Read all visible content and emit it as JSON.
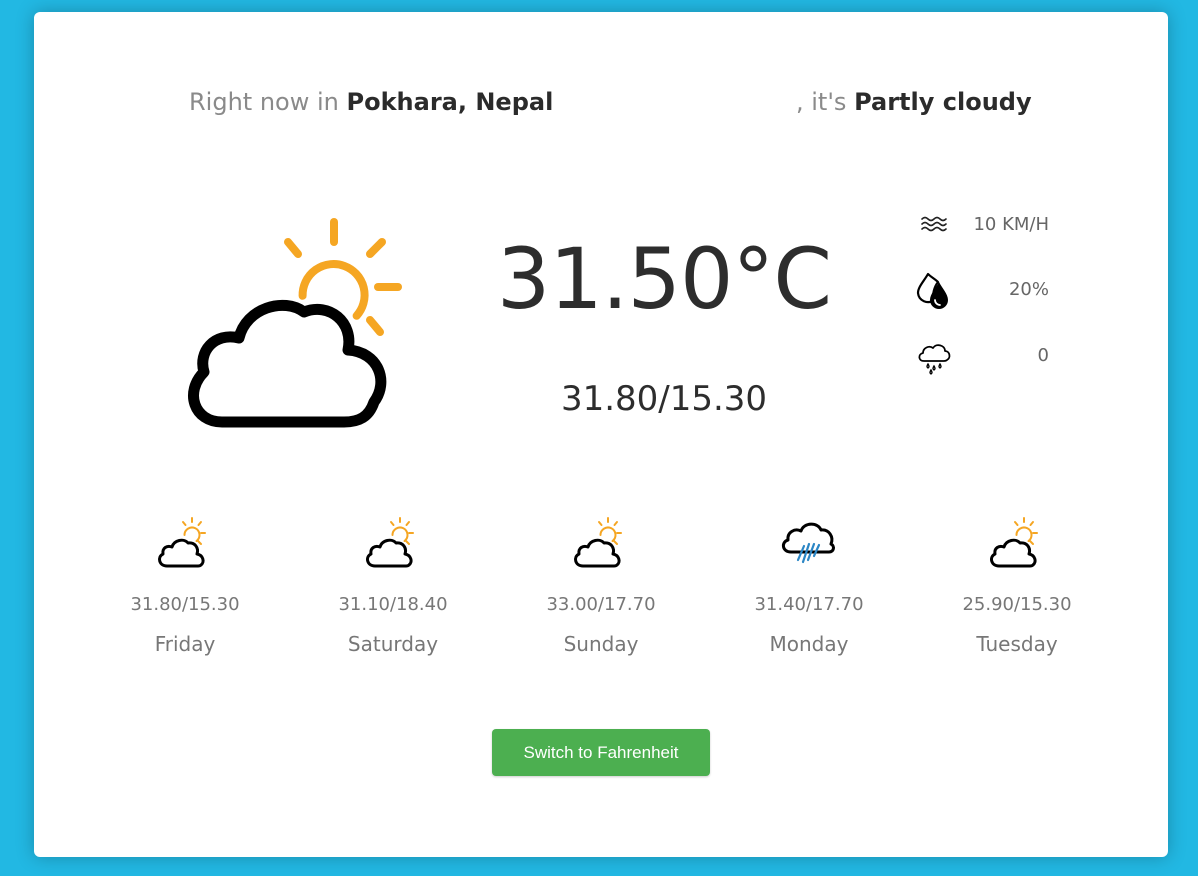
{
  "headline": {
    "prefix": "Right now in ",
    "location": "Pokhara, Nepal",
    "mid": ", it's ",
    "condition": "Partly cloudy"
  },
  "current": {
    "icon": "partly-cloudy-icon",
    "temperature": "31.50°C",
    "range": "31.80/15.30"
  },
  "stats": {
    "wind": {
      "icon": "wind-icon",
      "value": "10 KM/H"
    },
    "humidity": {
      "icon": "humidity-icon",
      "value": "20%"
    },
    "precipitation": {
      "icon": "rain-cloud-icon",
      "value": "0"
    }
  },
  "forecast": [
    {
      "day": "Friday",
      "range": "31.80/15.30",
      "icon": "partly-cloudy-icon"
    },
    {
      "day": "Saturday",
      "range": "31.10/18.40",
      "icon": "partly-cloudy-icon"
    },
    {
      "day": "Sunday",
      "range": "33.00/17.70",
      "icon": "partly-cloudy-icon"
    },
    {
      "day": "Monday",
      "range": "31.40/17.70",
      "icon": "rain-icon"
    },
    {
      "day": "Tuesday",
      "range": "25.90/15.30",
      "icon": "partly-cloudy-icon"
    }
  ],
  "button": {
    "label": "Switch to Fahrenheit"
  },
  "colors": {
    "background": "#22b8e3",
    "sun": "#f5a623",
    "rain": "#2b86c5",
    "button": "#4caf50"
  }
}
